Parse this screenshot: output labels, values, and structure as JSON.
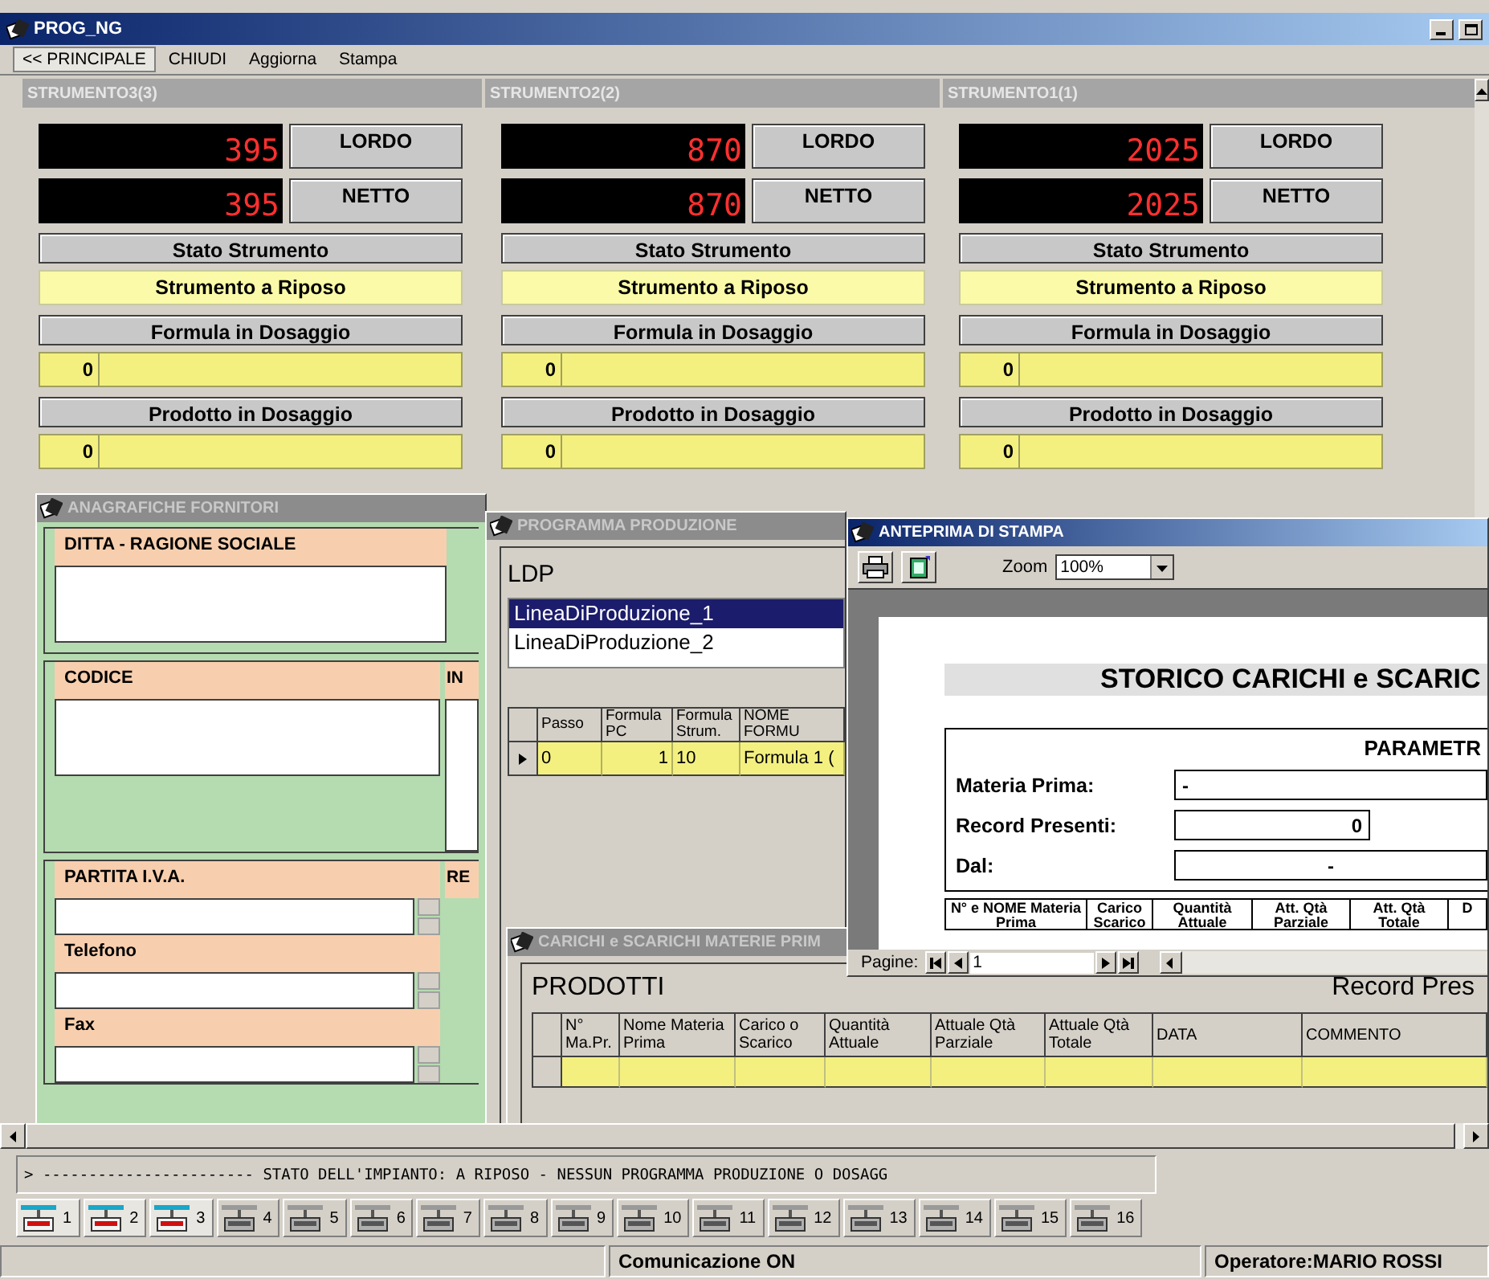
{
  "window": {
    "title": "PROG_NG"
  },
  "menu": [
    {
      "label": "<< PRINCIPALE",
      "selected": true
    },
    {
      "label": "CHIUDI",
      "selected": false
    },
    {
      "label": "Aggiorna",
      "selected": false
    },
    {
      "label": "Stampa",
      "selected": false
    }
  ],
  "instruments": [
    {
      "title": "STRUMENTO3(3)",
      "gross": "395",
      "gross_label": "LORDO",
      "net": "395",
      "net_label": "NETTO",
      "state_label": "Stato Strumento",
      "state": "Strumento a Riposo",
      "formula_label": "Formula in Dosaggio",
      "formula_code": "0",
      "product_label": "Prodotto in Dosaggio",
      "product_code": "0"
    },
    {
      "title": "STRUMENTO2(2)",
      "gross": "870",
      "gross_label": "LORDO",
      "net": "870",
      "net_label": "NETTO",
      "state_label": "Stato Strumento",
      "state": "Strumento a Riposo",
      "formula_label": "Formula in Dosaggio",
      "formula_code": "0",
      "product_label": "Prodotto in Dosaggio",
      "product_code": "0"
    },
    {
      "title": "STRUMENTO1(1)",
      "gross": "2025",
      "gross_label": "LORDO",
      "net": "2025",
      "net_label": "NETTO",
      "state_label": "Stato Strumento",
      "state": "Strumento a Riposo",
      "formula_label": "Formula in Dosaggio",
      "formula_code": "0",
      "product_label": "Prodotto in Dosaggio",
      "product_code": "0"
    }
  ],
  "suppliers": {
    "title": "ANAGRAFICHE FORNITORI",
    "company_label": "DITTA - RAGIONE SOCIALE",
    "code_label": "CODICE",
    "column_2_label": "IN",
    "vat_label": "PARTITA I.V.A.",
    "column_2b_label": "RE",
    "phone_label": "Telefono",
    "fax_label": "Fax"
  },
  "production": {
    "title": "PROGRAMMA PRODUZIONE",
    "list_label": "LDP",
    "lines": [
      {
        "label": "LineaDiProduzione_1",
        "selected": true
      },
      {
        "label": "LineaDiProduzione_2",
        "selected": false
      }
    ],
    "columns": [
      "Passo",
      "Formula PC",
      "Formula Strum.",
      "NOME FORMU"
    ],
    "rows": [
      {
        "current": true,
        "cells": [
          "0",
          "1",
          "10",
          "Formula 1 ("
        ]
      }
    ]
  },
  "movements": {
    "title": "CARICHI e SCARICHI MATERIE PRIM",
    "heading": "PRODOTTI",
    "record_label": "Record Pres",
    "columns": [
      "N° Ma.Pr.",
      "Nome Materia Prima",
      "Carico o Scarico",
      "Quantità Attuale",
      "Attuale Qtà Parziale",
      "Attuale Qtà Totale",
      "DATA",
      "COMMENTO"
    ]
  },
  "print_preview": {
    "title": "ANTEPRIMA DI STAMPA",
    "zoom_label": "Zoom",
    "zoom": "100%",
    "report_title": "STORICO CARICHI e SCARIC",
    "params_title": "PARAMETR",
    "params": [
      {
        "label": "Materia Prima:",
        "value": "-",
        "kind": "text"
      },
      {
        "label": "Record Presenti:",
        "value": "0",
        "kind": "number"
      },
      {
        "label": "Dal:",
        "value": "-",
        "kind": "date"
      }
    ],
    "columns": [
      "N° e NOME Materia Prima",
      "Carico Scarico",
      "Quantità Attuale",
      "Att. Qtà Parziale",
      "Att. Qtà Totale",
      "D"
    ],
    "pages_label": "Pagine:",
    "page": "1"
  },
  "status_message": "> ----------------------- STATO DELL'IMPIANTO: A RIPOSO - NESSUN PROGRAMMA PRODUZIONE O DOSAGG",
  "devices": [
    {
      "label": "1",
      "active": true
    },
    {
      "label": "2",
      "active": true
    },
    {
      "label": "3",
      "active": true
    },
    {
      "label": "4",
      "active": false
    },
    {
      "label": "5",
      "active": false
    },
    {
      "label": "6",
      "active": false
    },
    {
      "label": "7",
      "active": false
    },
    {
      "label": "8",
      "active": false
    },
    {
      "label": "9",
      "active": false
    },
    {
      "label": "10",
      "active": false
    },
    {
      "label": "11",
      "active": false
    },
    {
      "label": "12",
      "active": false
    },
    {
      "label": "13",
      "active": false
    },
    {
      "label": "14",
      "active": false
    },
    {
      "label": "15",
      "active": false
    },
    {
      "label": "16",
      "active": false
    }
  ],
  "status_bar": [
    "Comunicazione ON",
    "Operatore:MARIO ROSSI"
  ]
}
